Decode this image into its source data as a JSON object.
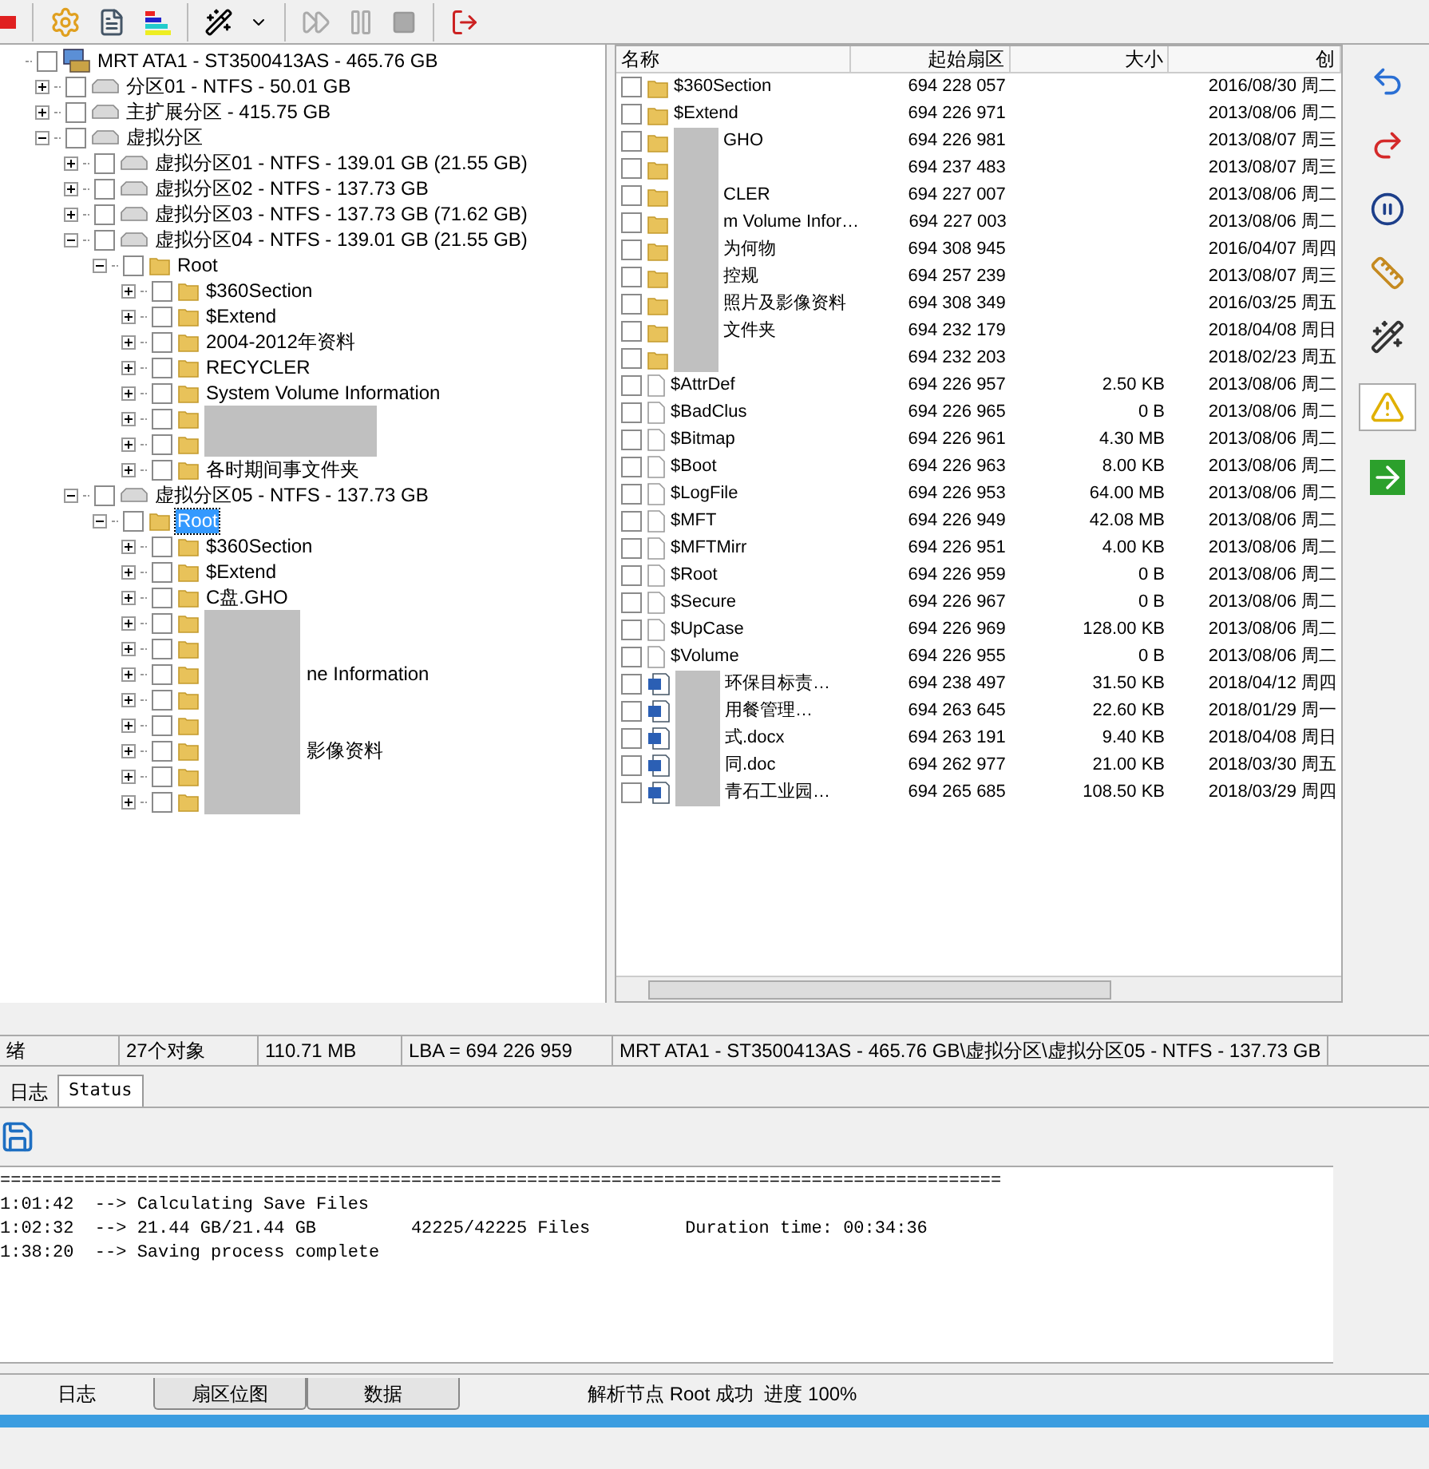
{
  "tree": [
    {
      "kind": "computer",
      "label": "MRT ATA1 - ST3500413AS - 465.76 GB",
      "checked": false,
      "selected": false,
      "children": [
        {
          "kind": "disk",
          "label": "分区01 - NTFS - 50.01 GB",
          "checked": false,
          "selected": false,
          "expanded": false
        },
        {
          "kind": "disk",
          "label": "主扩展分区 - 415.75 GB",
          "checked": false,
          "selected": false,
          "expanded": false
        },
        {
          "kind": "disk",
          "label": "虚拟分区",
          "checked": false,
          "selected": false,
          "expanded": true,
          "children": [
            {
              "kind": "disk",
              "label": "虚拟分区01 - NTFS - 139.01 GB (21.55 GB)",
              "checked": false,
              "selected": false,
              "expanded": false
            },
            {
              "kind": "disk",
              "label": "虚拟分区02 - NTFS - 137.73 GB",
              "checked": false,
              "selected": false,
              "expanded": false
            },
            {
              "kind": "disk",
              "label": "虚拟分区03 - NTFS - 137.73 GB (71.62 GB)",
              "checked": false,
              "selected": false,
              "expanded": false
            },
            {
              "kind": "disk",
              "label": "虚拟分区04 - NTFS - 139.01 GB (21.55 GB)",
              "checked": false,
              "selected": false,
              "expanded": true,
              "children": [
                {
                  "kind": "folder",
                  "label": "Root",
                  "checked": false,
                  "selected": false,
                  "expanded": true,
                  "children": [
                    {
                      "kind": "folder",
                      "label": "$360Section",
                      "checked": false,
                      "selected": false,
                      "expanded": false
                    },
                    {
                      "kind": "folder",
                      "label": "$Extend",
                      "checked": false,
                      "selected": false,
                      "expanded": false
                    },
                    {
                      "kind": "folder",
                      "label": "2004-2012年资料",
                      "checked": false,
                      "selected": false,
                      "expanded": false
                    },
                    {
                      "kind": "folder",
                      "label": "RECYCLER",
                      "checked": false,
                      "selected": false,
                      "expanded": false
                    },
                    {
                      "kind": "folder",
                      "label": "System Volume Information",
                      "checked": false,
                      "selected": false,
                      "expanded": false
                    },
                    {
                      "kind": "folder",
                      "masked": true,
                      "mask_wide": true,
                      "checked": false,
                      "selected": false,
                      "expanded": false
                    },
                    {
                      "kind": "folder",
                      "masked": true,
                      "mask_wide": true,
                      "checked": false,
                      "selected": false,
                      "expanded": false
                    },
                    {
                      "kind": "folder",
                      "label": "各时期间事文件夹",
                      "checked": false,
                      "selected": false,
                      "expanded": false
                    }
                  ]
                }
              ]
            },
            {
              "kind": "disk",
              "label": "虚拟分区05 - NTFS - 137.73 GB",
              "checked": false,
              "selected": false,
              "expanded": true,
              "children": [
                {
                  "kind": "folder",
                  "label": "Root",
                  "checked": false,
                  "selected": true,
                  "expanded": true,
                  "children": [
                    {
                      "kind": "folder",
                      "label": "$360Section",
                      "checked": false,
                      "selected": false,
                      "expanded": false
                    },
                    {
                      "kind": "folder",
                      "label": "$Extend",
                      "checked": false,
                      "selected": false,
                      "expanded": false
                    },
                    {
                      "kind": "folder",
                      "label": "C盘.GHO",
                      "checked": false,
                      "selected": false,
                      "expanded": false
                    },
                    {
                      "kind": "folder",
                      "masked": true,
                      "mask_wide": false,
                      "checked": false,
                      "selected": false,
                      "expanded": false
                    },
                    {
                      "kind": "folder",
                      "masked": true,
                      "mask_wide": false,
                      "checked": false,
                      "selected": false,
                      "expanded": false
                    },
                    {
                      "kind": "folder",
                      "masked": true,
                      "mask_wide": false,
                      "label": "ne Information",
                      "checked": false,
                      "selected": false,
                      "expanded": false
                    },
                    {
                      "kind": "folder",
                      "masked": true,
                      "mask_wide": false,
                      "checked": false,
                      "selected": false,
                      "expanded": false
                    },
                    {
                      "kind": "folder",
                      "masked": true,
                      "mask_wide": false,
                      "checked": false,
                      "selected": false,
                      "expanded": false
                    },
                    {
                      "kind": "folder",
                      "masked": true,
                      "mask_wide": false,
                      "label": "影像资料",
                      "checked": false,
                      "selected": false,
                      "expanded": false
                    },
                    {
                      "kind": "folder",
                      "masked": true,
                      "mask_wide": false,
                      "checked": false,
                      "selected": false,
                      "expanded": false
                    },
                    {
                      "kind": "folder",
                      "masked": true,
                      "mask_wide": false,
                      "checked": false,
                      "selected": false,
                      "expanded": false
                    }
                  ]
                }
              ]
            }
          ]
        }
      ]
    }
  ],
  "file_list": {
    "columns": [
      "名称",
      "起始扇区",
      "大小",
      "创"
    ],
    "rows": [
      {
        "kind": "folder",
        "checked": false,
        "name": "$360Section",
        "sector": "694 228 057",
        "date": "2016/08/30 周二"
      },
      {
        "kind": "folder",
        "checked": false,
        "name": "$Extend",
        "sector": "694 226 971",
        "date": "2013/08/06 周二"
      },
      {
        "kind": "folder",
        "checked": false,
        "masked": true,
        "name": "GHO",
        "sector": "694 226 981",
        "date": "2013/08/07 周三"
      },
      {
        "kind": "folder",
        "checked": false,
        "masked": true,
        "sector": "694 237 483",
        "date": "2013/08/07 周三"
      },
      {
        "kind": "folder",
        "checked": false,
        "masked": true,
        "name": "CLER",
        "sector": "694 227 007",
        "date": "2013/08/06 周二"
      },
      {
        "kind": "folder",
        "checked": false,
        "masked": true,
        "name": "m Volume Infor…",
        "sector": "694 227 003",
        "date": "2013/08/06 周二"
      },
      {
        "kind": "folder",
        "checked": false,
        "masked": true,
        "name": "为何物",
        "sector": "694 308 945",
        "date": "2016/04/07 周四"
      },
      {
        "kind": "folder",
        "checked": false,
        "masked": true,
        "name": "控规",
        "sector": "694 257 239",
        "date": "2013/08/07 周三"
      },
      {
        "kind": "folder",
        "checked": false,
        "masked": true,
        "name": "照片及影像资料",
        "sector": "694 308 349",
        "date": "2016/03/25 周五"
      },
      {
        "kind": "folder",
        "checked": false,
        "masked": true,
        "name": "文件夹",
        "sector": "694 232 179",
        "date": "2018/04/08 周日"
      },
      {
        "kind": "folder",
        "checked": false,
        "masked": true,
        "sector": "694 232 203",
        "date": "2018/02/23 周五"
      },
      {
        "kind": "file",
        "checked": false,
        "name": "$AttrDef",
        "sector": "694 226 957",
        "size": "2.50 KB",
        "date": "2013/08/06 周二"
      },
      {
        "kind": "file",
        "checked": false,
        "name": "$BadClus",
        "sector": "694 226 965",
        "size": "0 B",
        "date": "2013/08/06 周二"
      },
      {
        "kind": "file",
        "checked": false,
        "name": "$Bitmap",
        "sector": "694 226 961",
        "size": "4.30 MB",
        "date": "2013/08/06 周二"
      },
      {
        "kind": "file",
        "checked": false,
        "name": "$Boot",
        "sector": "694 226 963",
        "size": "8.00 KB",
        "date": "2013/08/06 周二"
      },
      {
        "kind": "file",
        "checked": false,
        "name": "$LogFile",
        "sector": "694 226 953",
        "size": "64.00 MB",
        "date": "2013/08/06 周二"
      },
      {
        "kind": "file",
        "checked": false,
        "name": "$MFT",
        "sector": "694 226 949",
        "size": "42.08 MB",
        "date": "2013/08/06 周二"
      },
      {
        "kind": "file",
        "checked": false,
        "name": "$MFTMirr",
        "sector": "694 226 951",
        "size": "4.00 KB",
        "date": "2013/08/06 周二"
      },
      {
        "kind": "file",
        "checked": false,
        "name": "$Root",
        "sector": "694 226 959",
        "size": "0 B",
        "date": "2013/08/06 周二"
      },
      {
        "kind": "file",
        "checked": false,
        "name": "$Secure",
        "sector": "694 226 967",
        "size": "0 B",
        "date": "2013/08/06 周二"
      },
      {
        "kind": "file",
        "checked": false,
        "name": "$UpCase",
        "sector": "694 226 969",
        "size": "128.00 KB",
        "date": "2013/08/06 周二"
      },
      {
        "kind": "file",
        "checked": false,
        "name": "$Volume",
        "sector": "694 226 955",
        "size": "0 B",
        "date": "2013/08/06 周二"
      },
      {
        "kind": "doc",
        "checked": false,
        "masked": true,
        "name": "环保目标责…",
        "sector": "694 238 497",
        "size": "31.50 KB",
        "date": "2018/04/12 周四"
      },
      {
        "kind": "doc",
        "checked": false,
        "masked": true,
        "name": "用餐管理…",
        "sector": "694 263 645",
        "size": "22.60 KB",
        "date": "2018/01/29 周一"
      },
      {
        "kind": "doc",
        "checked": false,
        "masked": true,
        "name": "式.docx",
        "sector": "694 263 191",
        "size": "9.40 KB",
        "date": "2018/04/08 周日"
      },
      {
        "kind": "doc",
        "checked": false,
        "masked": true,
        "name": "同.doc",
        "sector": "694 262 977",
        "size": "21.00 KB",
        "date": "2018/03/30 周五"
      },
      {
        "kind": "doc",
        "checked": false,
        "masked": true,
        "name": "青石工业园…",
        "sector": "694 265 685",
        "size": "108.50 KB",
        "date": "2018/03/29 周四"
      }
    ]
  },
  "status_bar": [
    "绪",
    "27个对象",
    "110.71 MB",
    "LBA = 694 226 959",
    "MRT ATA1 - ST3500413AS - 465.76 GB\\虚拟分区\\虚拟分区05 - NTFS - 137.73 GB"
  ],
  "log_tabs": [
    {
      "label": "日志",
      "selected": false
    },
    {
      "label": "Status",
      "selected": true
    }
  ],
  "log_lines": [
    "===============================================================================================",
    "1:01:42  --> Calculating Save Files",
    "1:02:32  --> 21.44 GB/21.44 GB         42225/42225 Files         Duration time: 00:34:36",
    "1:38:20  --> Saving process complete"
  ],
  "bottom_tabs": [
    {
      "label": "日志",
      "selected": true
    },
    {
      "label": "扇区位图",
      "selected": false
    },
    {
      "label": "数据",
      "selected": false
    }
  ],
  "bottom_status": "解析节点 Root 成功  进度 100%",
  "progress": {
    "level": 1
  }
}
